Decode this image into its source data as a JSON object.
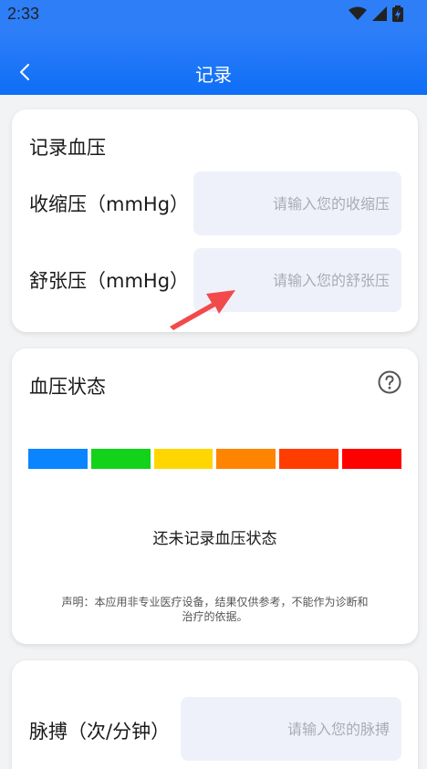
{
  "status_bar": {
    "time": "2:33",
    "icons": [
      "wifi-icon",
      "signal-icon",
      "battery-icon"
    ]
  },
  "header": {
    "title": "记录",
    "back_icon": "chevron-left-icon"
  },
  "record_card": {
    "title": "记录血压",
    "systolic": {
      "label": "收缩压（mmHg）",
      "value": "",
      "placeholder": "请输入您的收缩压"
    },
    "diastolic": {
      "label": "舒张压（mmHg）",
      "value": "",
      "placeholder": "请输入您的舒张压"
    }
  },
  "status_card": {
    "title": "血压状态",
    "help_icon": "help-icon",
    "levels": [
      {
        "color": "#0a84ff"
      },
      {
        "color": "#13d21a"
      },
      {
        "color": "#ffd600"
      },
      {
        "color": "#ff8400"
      },
      {
        "color": "#ff3d00"
      },
      {
        "color": "#ff0000"
      }
    ],
    "empty_text": "还未记录血压状态",
    "disclaimer": "声明：本应用非专业医疗设备，结果仅供参考，不能作为诊断和治疗的依据。"
  },
  "pulse_card": {
    "label": "脉搏（次/分钟）",
    "value": "",
    "placeholder": "请输入您的脉搏"
  },
  "colors": {
    "header": "#1574f6",
    "input_bg": "#eff1fa",
    "annotation_arrow": "#f24a4a"
  }
}
